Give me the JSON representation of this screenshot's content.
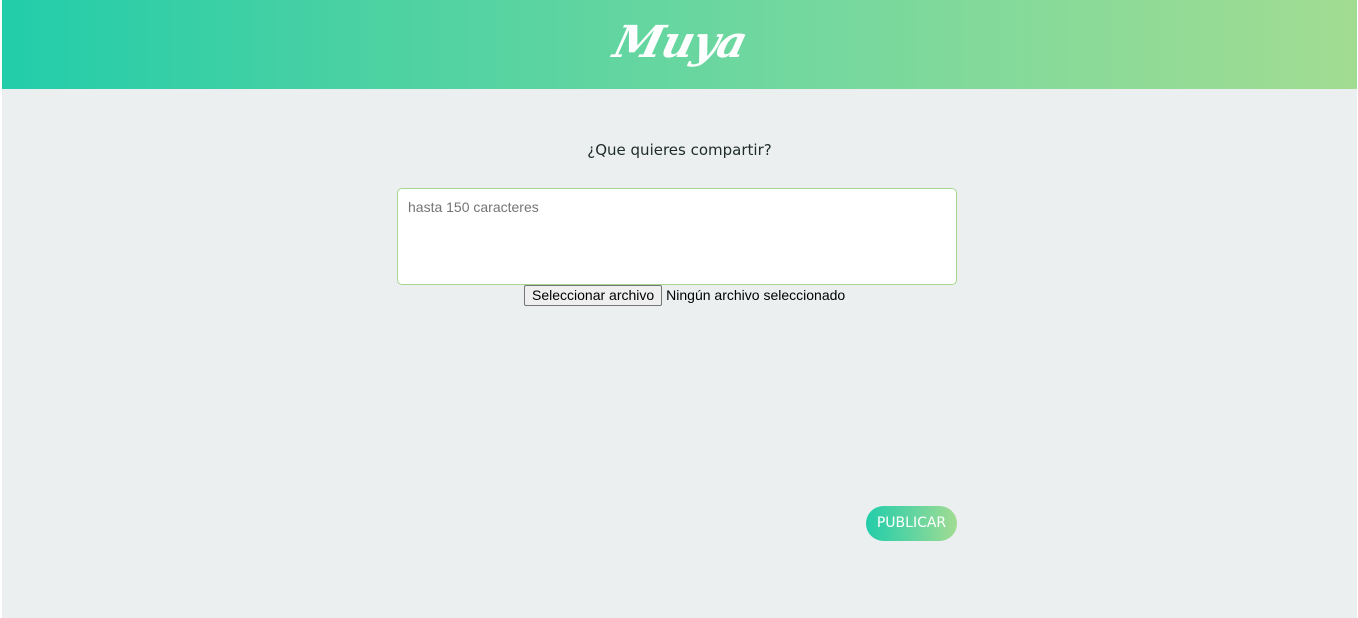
{
  "header": {
    "logo_text": "Muya",
    "gradient_start": "#22cdaa",
    "gradient_end": "#a2dc92"
  },
  "composer": {
    "prompt": "¿Que quieres compartir?",
    "textarea_value": "",
    "textarea_placeholder": "hasta 150 caracteres",
    "file_button_label": "Seleccionar archivo",
    "file_status": "Ningún archivo seleccionado",
    "publish_label": "PUBLICAR"
  },
  "colors": {
    "page_background": "#ebefef",
    "input_border": "#a8d68f"
  }
}
